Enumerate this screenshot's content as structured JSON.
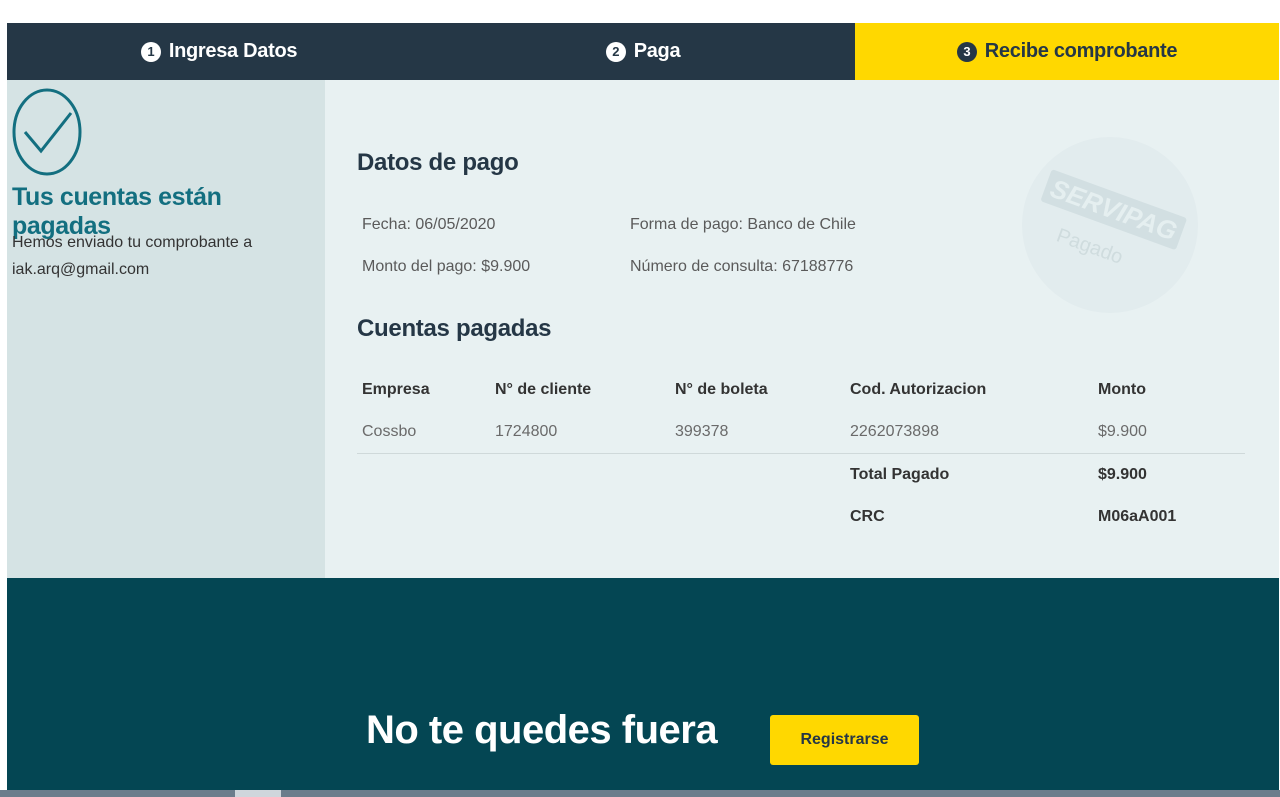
{
  "steps": [
    {
      "number": "1",
      "label": "Ingresa Datos"
    },
    {
      "number": "2",
      "label": "Paga"
    },
    {
      "number": "3",
      "label": "Recibe comprobante"
    }
  ],
  "sidebar": {
    "title": "Tus cuentas están pagadas",
    "message_line1": "Hemos enviado tu comprobante a",
    "email": "iak.arq@gmail.com"
  },
  "stamp": {
    "brand": "SERVIPAG",
    "status": "Pagado"
  },
  "payment": {
    "heading": "Datos de pago",
    "date": "Fecha: 06/05/2020",
    "method": "Forma de pago: Banco de Chile",
    "amount": "Monto del pago: $9.900",
    "query_number": "Número de consulta: 67188776"
  },
  "accounts": {
    "heading": "Cuentas pagadas",
    "columns": [
      "Empresa",
      "N° de cliente",
      "N° de boleta",
      "Cod. Autorizacion",
      "Monto"
    ],
    "rows": [
      [
        "Cossbo",
        "1724800",
        "399378",
        "2262073898",
        "$9.900"
      ]
    ],
    "total_label": "Total Pagado",
    "total_value": "$9.900",
    "crc_label": "CRC",
    "crc_value": "M06aA001"
  },
  "footer": {
    "title": "No te quedes fuera",
    "register_label": "Registrarse"
  },
  "colors": {
    "header_dark": "#253746",
    "active_step": "#ffd800",
    "footer_teal": "#044653",
    "title_teal": "#136f80"
  }
}
